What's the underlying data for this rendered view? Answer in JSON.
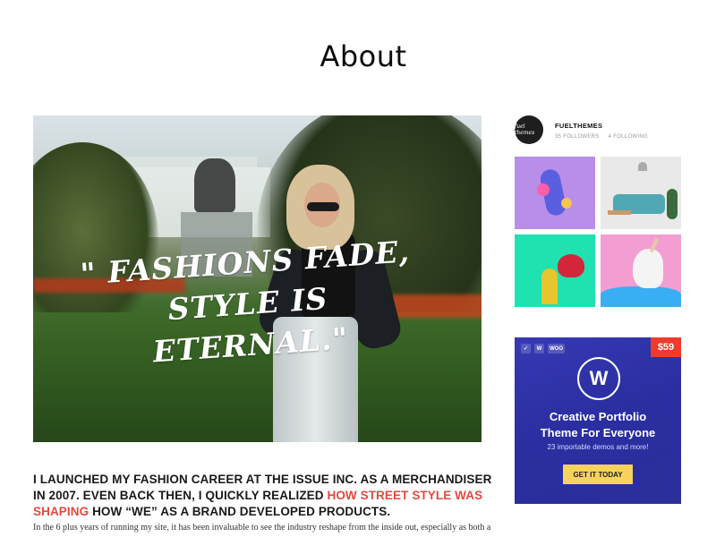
{
  "page": {
    "title": "About"
  },
  "hero": {
    "quote_line1": "\" FASHIONS FADE,",
    "quote_line2": "STYLE IS ETERNAL.\""
  },
  "article": {
    "lead_part1": "I LAUNCHED MY FASHION CAREER AT THE ISSUE INC. AS A MERCHANDISER IN 2007. EVEN BACK THEN, I QUICKLY REALIZED ",
    "lead_link": "HOW STREET STYLE WAS SHAPING",
    "lead_part2": " HOW “WE” AS A BRAND DEVELOPED PRODUCTS.",
    "body": "In the 6 plus years of running my site, it has been invaluable to see the industry reshape from the inside out, especially as both a",
    "link_color": "#e8473f"
  },
  "instagram": {
    "avatar_text": "fuel themes",
    "username": "FUELTHEMES",
    "followers": "35 FOLLOWERS",
    "following": "4 FOLLOWING",
    "tiles": [
      "purple-abstract-photo",
      "living-room-photo",
      "cactus-lips-photo",
      "unicorn-photo"
    ]
  },
  "ad": {
    "badges": [
      "✓",
      "W",
      "WOO"
    ],
    "price": "$59",
    "logo": "W",
    "title_line1": "Creative Portfolio",
    "title_line2": "Theme For Everyone",
    "subtitle": "23 importable demos and more!",
    "cta": "GET IT TODAY",
    "colors": {
      "background": "#2f33a8",
      "price": "#ef3b2d",
      "cta": "#f6d35c"
    }
  }
}
